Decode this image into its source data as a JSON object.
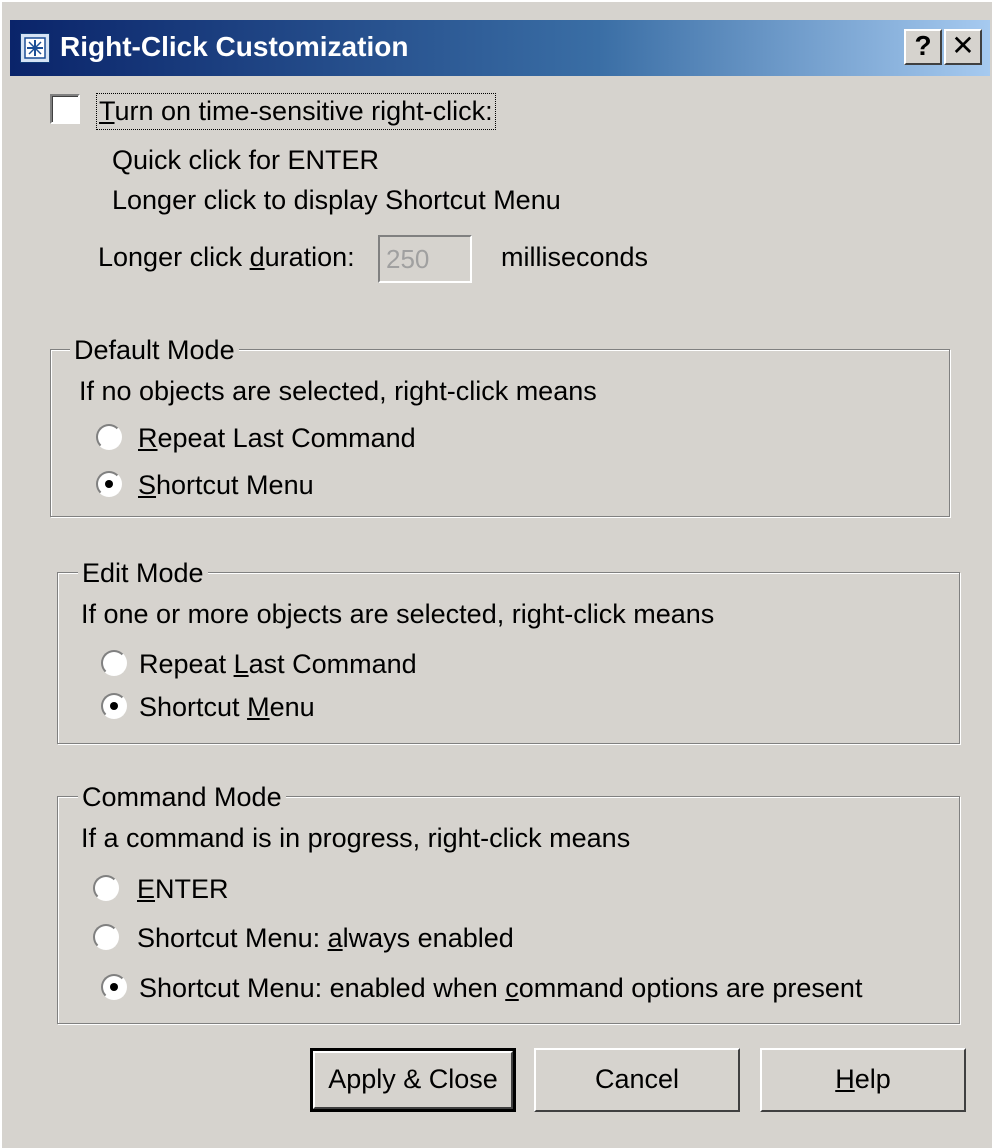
{
  "window": {
    "title": "Right-Click Customization",
    "help_button": "?",
    "close_button": "✕"
  },
  "time_sensitive": {
    "checkbox_label_pre": "",
    "checkbox_label_accel": "T",
    "checkbox_label_post": "urn on time-sensitive right-click:",
    "checked": false,
    "line1": "Quick click for ENTER",
    "line2": "Longer click to display Shortcut Menu",
    "duration_label_pre": "Longer click ",
    "duration_label_accel": "d",
    "duration_label_post": "uration:",
    "duration_value": "250",
    "duration_unit": "milliseconds"
  },
  "default_mode": {
    "legend": "Default Mode",
    "description": "If no objects are selected, right-click means",
    "options": [
      {
        "pre": "",
        "accel": "R",
        "post": "epeat Last Command",
        "selected": false
      },
      {
        "pre": "",
        "accel": "S",
        "post": "hortcut Menu",
        "selected": true
      }
    ]
  },
  "edit_mode": {
    "legend": "Edit Mode",
    "description": "If one or more objects are selected, right-click means",
    "options": [
      {
        "pre": "Repeat ",
        "accel": "L",
        "post": "ast Command",
        "selected": false
      },
      {
        "pre": "Shortcut ",
        "accel": "M",
        "post": "enu",
        "selected": true
      }
    ]
  },
  "command_mode": {
    "legend": "Command Mode",
    "description": "If a command is in progress, right-click means",
    "options": [
      {
        "pre": "",
        "accel": "E",
        "post": "NTER",
        "selected": false
      },
      {
        "pre": "Shortcut Menu: ",
        "accel": "a",
        "post": "lways enabled",
        "selected": false
      },
      {
        "pre": "Shortcut Menu: enabled when ",
        "accel": "c",
        "post": "ommand options are present",
        "selected": true
      }
    ]
  },
  "buttons": {
    "apply": "Apply & Close",
    "cancel": "Cancel",
    "help_pre": "",
    "help_accel": "H",
    "help_post": "elp"
  }
}
